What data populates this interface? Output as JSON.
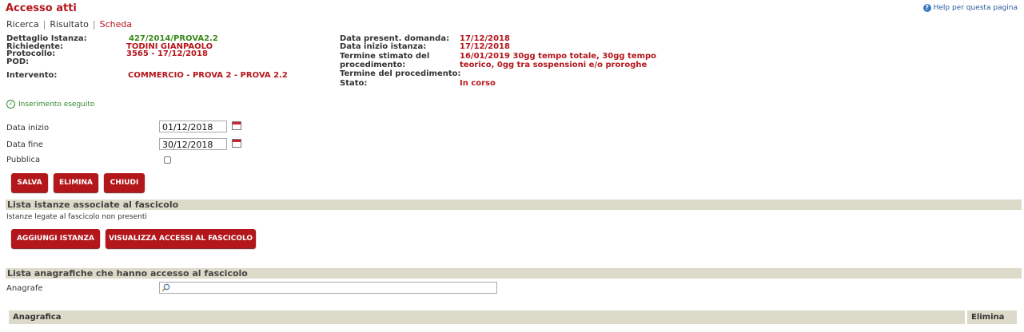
{
  "header": {
    "title": "Accesso atti",
    "help": "Help per questa pagina"
  },
  "breadcrumb": [
    "Ricerca",
    "Risultato",
    "Scheda"
  ],
  "details_left": [
    {
      "label": "Dettaglio Istanza:",
      "value": "427/2014/PROVA2.2"
    },
    {
      "label": "Richiedente:",
      "value": "TODINI GIANPAOLO"
    },
    {
      "label": "Protocollo:",
      "value": "3565 - 17/12/2018"
    },
    {
      "label": "POD:",
      "value": ""
    },
    {
      "label": "Intervento:",
      "value": "COMMERCIO - PROVA 2 - PROVA 2.2"
    }
  ],
  "details_right": [
    {
      "label": "Data present. domanda:",
      "value": "17/12/2018"
    },
    {
      "label": "Data inizio istanza:",
      "value": "17/12/2018"
    },
    {
      "label": "Termine stimato del",
      "value": "16/01/2019  30gg tempo totale, 30gg tempo"
    },
    {
      "label": "procedimento:",
      "value": "teorico, 0gg tra sospensioni e/o proroghe"
    },
    {
      "label": "Termine del procedimento:",
      "value": ""
    },
    {
      "label": "Stato:",
      "value": "In corso"
    }
  ],
  "status_message": "Inserimento eseguito",
  "form": {
    "start_label": "Data inizio",
    "start_value": "01/12/2018",
    "end_label": "Data fine",
    "end_value": "30/12/2018",
    "public_label": "Pubblica"
  },
  "buttons": {
    "save": "SALVA",
    "delete": "ELIMINA",
    "close": "CHIUDI"
  },
  "section1": {
    "title": "Lista istanze associate al fascicolo",
    "note": "Istanze legate al fascicolo non presenti",
    "add_button": "AGGIUNGI ISTANZA",
    "view_button": "VISUALIZZA ACCESSI AL FASCICOLO"
  },
  "section2": {
    "title": "Lista anagrafiche che hanno accesso al fascicolo",
    "search_label": "Anagrafe",
    "search_value": "",
    "col_anagrafica": "Anagrafica",
    "col_elimina": "Elimina"
  },
  "icons": {
    "help": "help-icon",
    "status": "check-circle-icon",
    "calendar": "calendar-icon",
    "search": "magnifier-icon"
  },
  "colors": {
    "accent": "#b4161b",
    "section_bg": "#dcdac8",
    "success": "#2e8b2e"
  }
}
